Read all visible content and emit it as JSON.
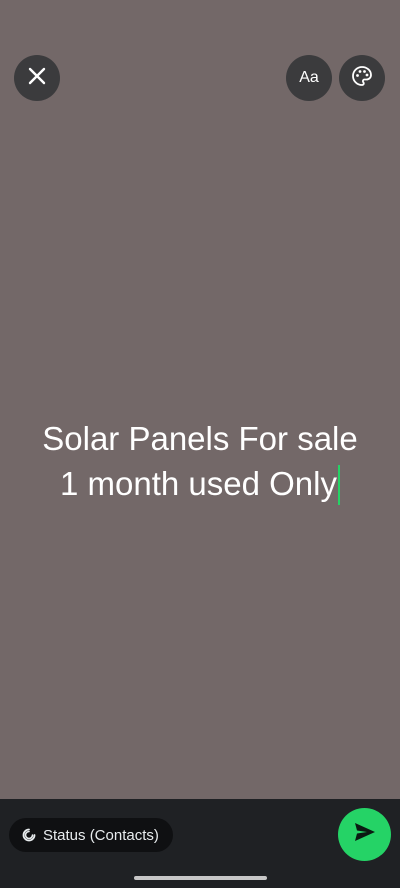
{
  "toolbar": {
    "close_icon": "close-icon",
    "font_button_label": "Aa",
    "palette_icon": "palette-icon"
  },
  "status_text": {
    "line1": "Solar Panels For sale",
    "line2": "1 month used Only"
  },
  "footer": {
    "audience_label": "Status (Contacts)",
    "audience_icon": "status-ring-icon",
    "send_icon": "send-icon"
  },
  "colors": {
    "background": "#736868",
    "accent": "#25d366",
    "bottom_bar": "#1f2124"
  }
}
